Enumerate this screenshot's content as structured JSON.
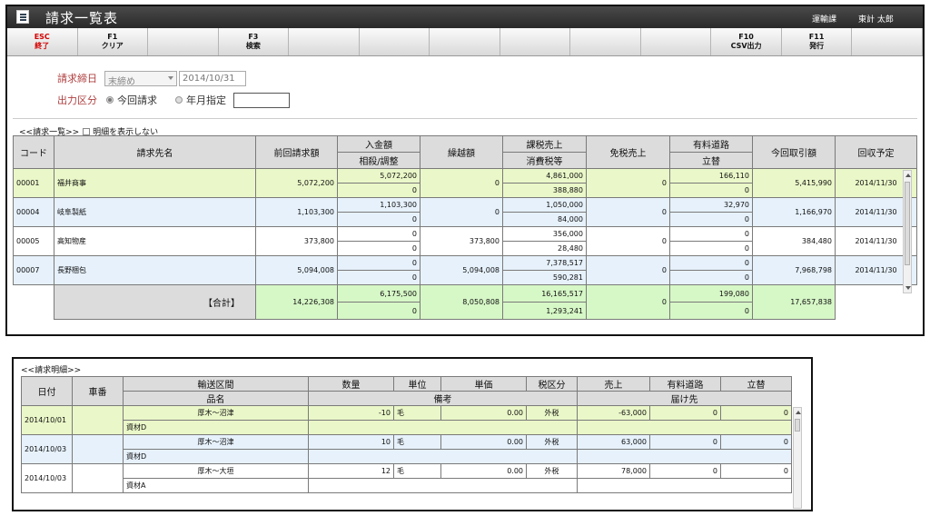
{
  "window": {
    "title": "請求一覧表",
    "department": "運輸課",
    "user": "東計 太郎"
  },
  "fkeys": [
    {
      "key": "ESC",
      "label": "終了"
    },
    {
      "key": "F1",
      "label": "クリア"
    },
    {
      "key": "",
      "label": ""
    },
    {
      "key": "F3",
      "label": "検索"
    },
    {
      "key": "",
      "label": ""
    },
    {
      "key": "",
      "label": ""
    },
    {
      "key": "",
      "label": ""
    },
    {
      "key": "",
      "label": ""
    },
    {
      "key": "",
      "label": ""
    },
    {
      "key": "",
      "label": ""
    },
    {
      "key": "F10",
      "label": "CSV出力"
    },
    {
      "key": "F11",
      "label": "発行"
    },
    {
      "key": "",
      "label": ""
    }
  ],
  "filters": {
    "closing_label": "請求締日",
    "closing_select": "末締め",
    "closing_date": "2014/10/31",
    "output_label": "出力区分",
    "radio_current": "今回請求",
    "radio_month": "年月指定",
    "month_value": ""
  },
  "invoice_list": {
    "section_title": "<<請求一覧>>",
    "hide_detail_label": "明細を表示しない",
    "headers": {
      "code": "コード",
      "customer": "請求先名",
      "prev": "前回請求額",
      "payment": "入金額",
      "offset": "相殺/調整",
      "carry": "繰越額",
      "taxable": "課税売上",
      "tax": "消費税等",
      "exempt": "免税売上",
      "toll": "有料道路",
      "advance": "立替",
      "current": "今回取引額",
      "due": "回収予定"
    },
    "rows": [
      {
        "code": "00001",
        "name": "福井商事",
        "prev": "5,072,200",
        "payment": "5,072,200",
        "offset": "0",
        "carry": "0",
        "taxable": "4,861,000",
        "tax": "388,880",
        "exempt": "0",
        "toll": "166,110",
        "advance": "0",
        "current": "5,415,990",
        "due": "2014/11/30"
      },
      {
        "code": "00004",
        "name": "岐阜製紙",
        "prev": "1,103,300",
        "payment": "1,103,300",
        "offset": "0",
        "carry": "0",
        "taxable": "1,050,000",
        "tax": "84,000",
        "exempt": "0",
        "toll": "32,970",
        "advance": "0",
        "current": "1,166,970",
        "due": "2014/11/30"
      },
      {
        "code": "00005",
        "name": "高知物産",
        "prev": "373,800",
        "payment": "0",
        "offset": "0",
        "carry": "373,800",
        "taxable": "356,000",
        "tax": "28,480",
        "exempt": "0",
        "toll": "0",
        "advance": "0",
        "current": "384,480",
        "due": "2014/11/30"
      },
      {
        "code": "00007",
        "name": "長野梱包",
        "prev": "5,094,008",
        "payment": "0",
        "offset": "0",
        "carry": "5,094,008",
        "taxable": "7,378,517",
        "tax": "590,281",
        "exempt": "0",
        "toll": "0",
        "advance": "0",
        "current": "7,968,798",
        "due": "2014/11/30"
      }
    ],
    "total": {
      "label": "【合計】",
      "prev": "14,226,308",
      "payment": "6,175,500",
      "offset": "0",
      "carry": "8,050,808",
      "taxable": "16,165,517",
      "tax": "1,293,241",
      "exempt": "0",
      "toll": "199,080",
      "advance": "0",
      "current": "17,657,838"
    }
  },
  "invoice_detail": {
    "section_title": "<<請求明細>>",
    "headers": {
      "date": "日付",
      "vehicle": "車番",
      "route": "輸送区間",
      "qty": "数量",
      "unit": "単位",
      "price": "単価",
      "tax_type": "税区分",
      "sales": "売上",
      "toll": "有料道路",
      "advance": "立替",
      "item": "品名",
      "remarks": "備考",
      "dest": "届け先"
    },
    "rows": [
      {
        "date": "2014/10/01",
        "vehicle": "",
        "route": "厚木～沼津",
        "qty": "-10",
        "unit": "毛",
        "price": "0.00",
        "tax": "外税",
        "sales": "-63,000",
        "toll": "0",
        "advance": "0",
        "item": "資材D",
        "remarks": "",
        "dest": ""
      },
      {
        "date": "2014/10/03",
        "vehicle": "",
        "route": "厚木～沼津",
        "qty": "10",
        "unit": "毛",
        "price": "0.00",
        "tax": "外税",
        "sales": "63,000",
        "toll": "0",
        "advance": "0",
        "item": "資材D",
        "remarks": "",
        "dest": ""
      },
      {
        "date": "2014/10/03",
        "vehicle": "",
        "route": "厚木～大垣",
        "qty": "12",
        "unit": "毛",
        "price": "0.00",
        "tax": "外税",
        "sales": "78,000",
        "toll": "0",
        "advance": "0",
        "item": "資材A",
        "remarks": "",
        "dest": ""
      }
    ]
  }
}
